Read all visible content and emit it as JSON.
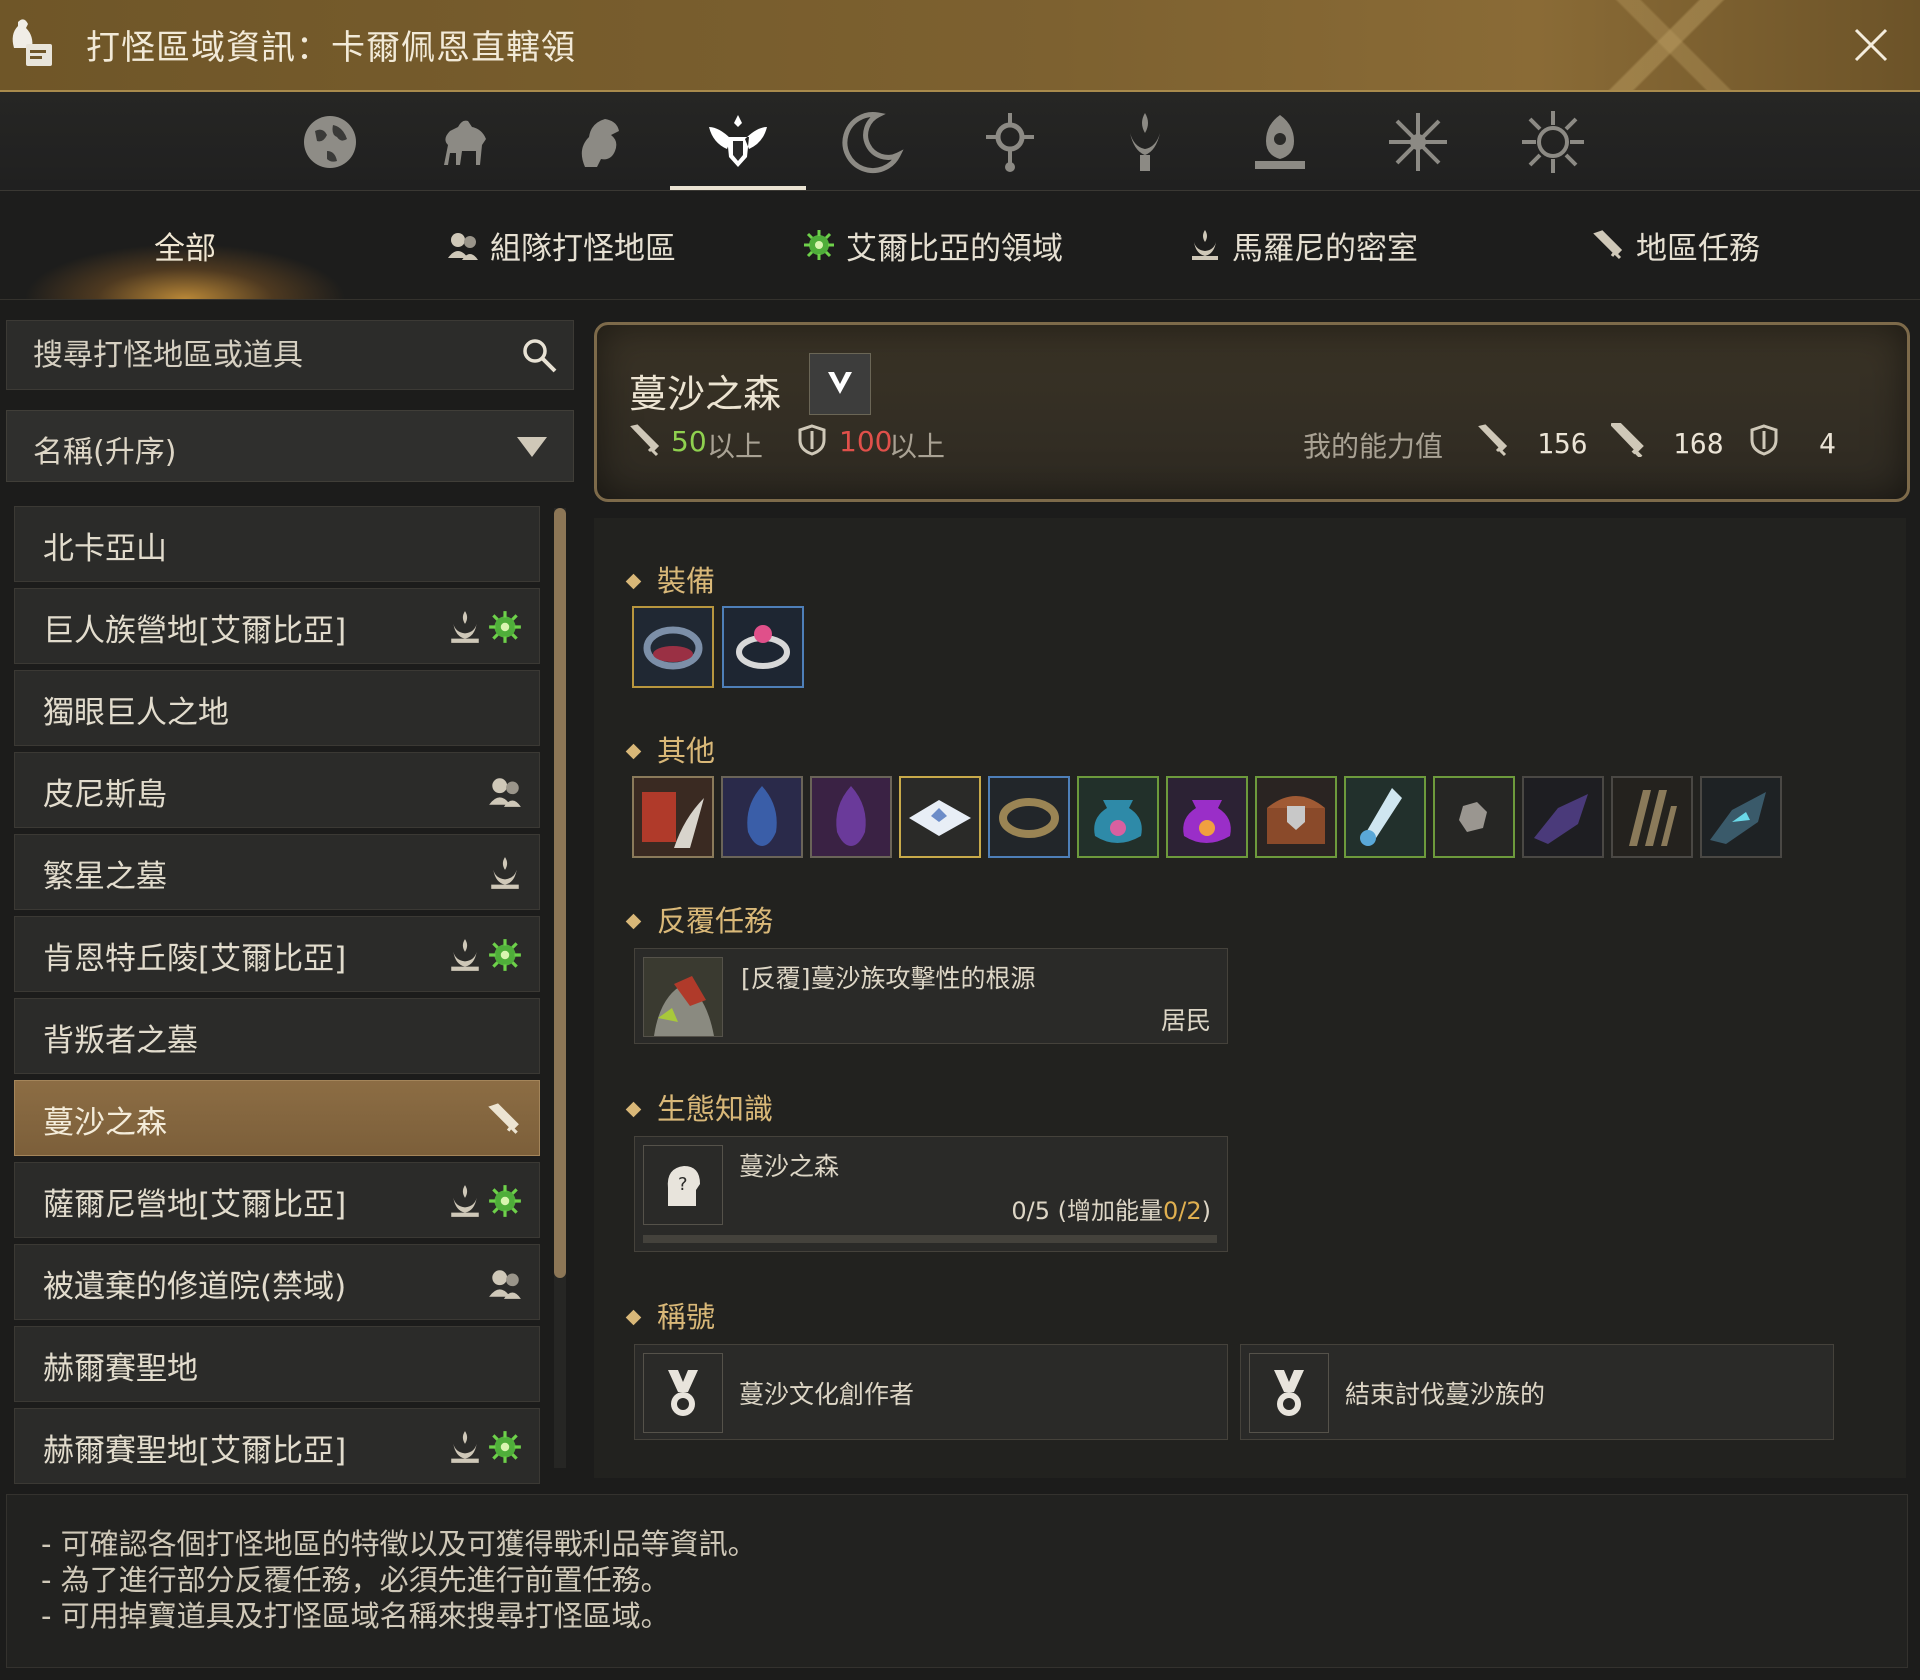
{
  "window": {
    "title": "打怪區域資訊：卡爾佩恩直轄領"
  },
  "regions": {
    "icons": [
      "globe-icon",
      "horse-icon",
      "lion-icon",
      "winged-crest-icon",
      "crescent-moon-icon",
      "sun-ring-icon",
      "flame-tree-icon",
      "lotus-crown-icon",
      "snowflake-star-icon",
      "radiant-star-icon"
    ],
    "active_index": 3
  },
  "categories": [
    {
      "label": "全部",
      "icon": ""
    },
    {
      "label": "組隊打怪地區",
      "icon": "party-icon"
    },
    {
      "label": "艾爾比亞的領域",
      "icon": "elvia-icon"
    },
    {
      "label": "馬羅尼的密室",
      "icon": "flame-crown-icon"
    },
    {
      "label": "地區任務",
      "icon": "quest-sword-icon"
    }
  ],
  "search": {
    "placeholder": "搜尋打怪地區或道具"
  },
  "sort": {
    "selected": "名稱(升序)"
  },
  "zones": [
    {
      "label": "北卡亞山",
      "tags": []
    },
    {
      "label": "巨人族營地[艾爾比亞]",
      "tags": [
        "flame-crown-icon",
        "elvia-icon"
      ]
    },
    {
      "label": "獨眼巨人之地",
      "tags": []
    },
    {
      "label": "皮尼斯島",
      "tags": [
        "party-icon"
      ]
    },
    {
      "label": "繁星之墓",
      "tags": [
        "flame-crown-icon"
      ]
    },
    {
      "label": "肯恩特丘陵[艾爾比亞]",
      "tags": [
        "flame-crown-icon",
        "elvia-icon"
      ]
    },
    {
      "label": "背叛者之墓",
      "tags": []
    },
    {
      "label": "蔓沙之森",
      "tags": [
        "quest-sword-icon"
      ],
      "selected": true
    },
    {
      "label": "薩爾尼營地[艾爾比亞]",
      "tags": [
        "flame-crown-icon",
        "elvia-icon"
      ]
    },
    {
      "label": "被遺棄的修道院(禁域)",
      "tags": [
        "party-icon"
      ]
    },
    {
      "label": "赫爾賽聖地",
      "tags": []
    },
    {
      "label": "赫爾賽聖地[艾爾比亞]",
      "tags": [
        "flame-crown-icon",
        "elvia-icon"
      ]
    }
  ],
  "zone_detail": {
    "name": "蔓沙之森",
    "req_ap": "50",
    "req_ap_suffix": "以上",
    "req_dp": "100",
    "req_dp_suffix": "以上",
    "my_stats_label": "我的能力值",
    "my_ap": "156",
    "my_awk_ap": "168",
    "my_dp": "4",
    "colors": {
      "ap_ok": "#8fd14f",
      "dp_fail": "#e0504a",
      "accent": "#d9b878"
    }
  },
  "sections": {
    "equipment": "裝備",
    "other": "其他",
    "repeat_quest": "反覆任務",
    "ecology": "生態知識",
    "titles": "稱號"
  },
  "equipment_items": [
    {
      "icon": "dark-bracelet-icon",
      "border": "#b8963e"
    },
    {
      "icon": "pink-gem-ring-icon",
      "border": "#4e7fb8"
    }
  ],
  "other_items": [
    {
      "icon": "red-scroll-claw-icon",
      "border": "#8a7a5a"
    },
    {
      "icon": "blue-crystal-shard-icon",
      "border": "#6a6458"
    },
    {
      "icon": "purple-crystal-shard-icon",
      "border": "#6a6458"
    },
    {
      "icon": "white-tile-icon",
      "border": "#c8aa4a"
    },
    {
      "icon": "bronze-ring-icon",
      "border": "#4e7fb8"
    },
    {
      "icon": "blue-pouch-icon",
      "border": "#6d9a3c"
    },
    {
      "icon": "purple-pouch-icon",
      "border": "#6d9a3c"
    },
    {
      "icon": "treasure-chest-icon",
      "border": "#6d9a3c"
    },
    {
      "icon": "potion-vial-icon",
      "border": "#6d9a3c"
    },
    {
      "icon": "gray-ore-icon",
      "border": "#6d9a3c"
    },
    {
      "icon": "dark-crystal-icon",
      "border": "#4a4844"
    },
    {
      "icon": "wood-bundle-icon",
      "border": "#4a4844"
    },
    {
      "icon": "cyan-ore-icon",
      "border": "#4a4844"
    }
  ],
  "repeat_quest": {
    "title": "[反覆]蔓沙族攻擊性的根源",
    "giver": "居民"
  },
  "ecology": {
    "name": "蔓沙之森",
    "progress_prefix": "0/5 (增加能量",
    "progress_energy": "0/2",
    "progress_suffix": ")",
    "progress_fraction": 0
  },
  "titles": [
    {
      "label": "蔓沙文化創作者"
    },
    {
      "label": "結束討伐蔓沙族的"
    }
  ],
  "info_lines": [
    "- 可確認各個打怪地區的特徵以及可獲得戰利品等資訊。",
    "- 為了進行部分反覆任務，必須先進行前置任務。",
    "- 可用掉寶道具及打怪區域名稱來搜尋打怪區域。"
  ]
}
